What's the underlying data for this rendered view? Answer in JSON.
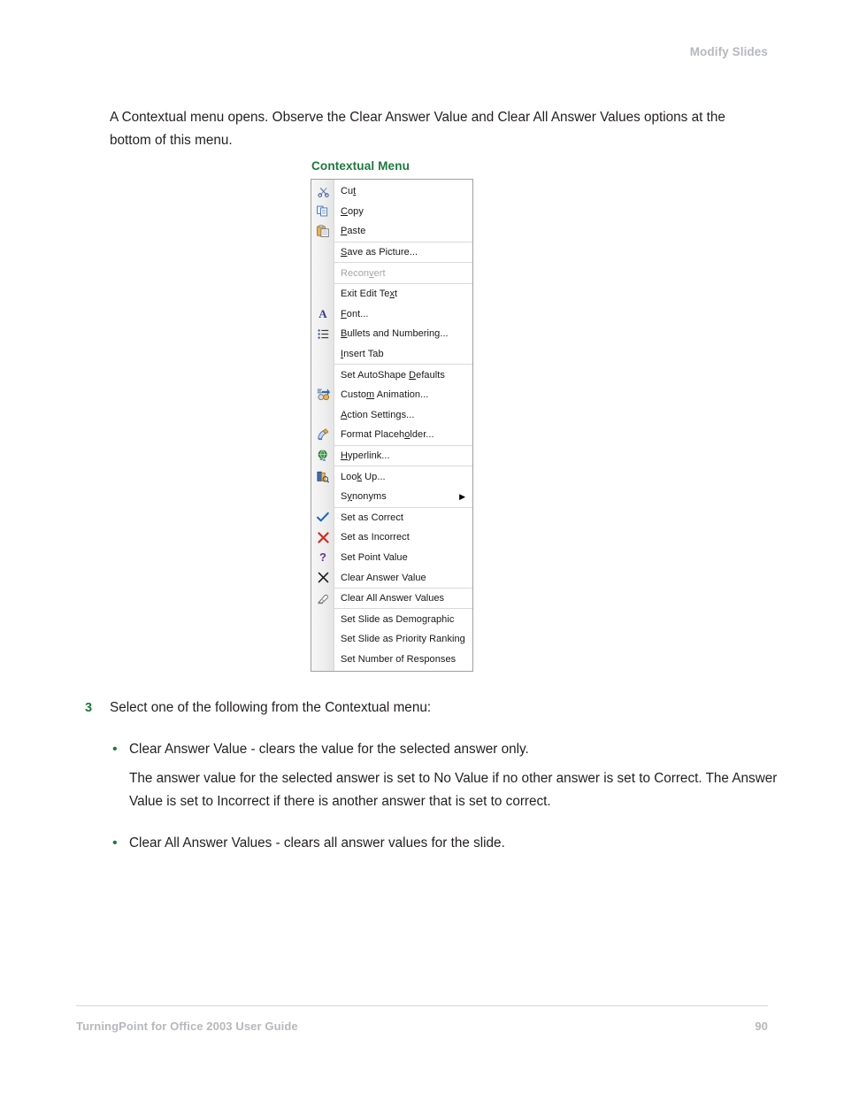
{
  "header": {
    "running_title": "Modify Slides"
  },
  "intro": "A Contextual menu opens. Observe the Clear Answer Value and Clear All Answer Values options at the bottom of this menu.",
  "figure": {
    "caption": "Contextual Menu",
    "menu_items": [
      {
        "label": "Cut",
        "icon": "scissors-icon",
        "glyph": "✂",
        "enabled": true,
        "submenu": false
      },
      {
        "label": "Copy",
        "icon": "copy-icon",
        "glyph": "",
        "enabled": true,
        "submenu": false
      },
      {
        "label": "Paste",
        "icon": "paste-icon",
        "glyph": "",
        "enabled": true,
        "submenu": false
      },
      {
        "label": "Save as Picture...",
        "icon": "",
        "glyph": "",
        "enabled": true,
        "submenu": false
      },
      {
        "label": "Reconvert",
        "icon": "",
        "glyph": "",
        "enabled": false,
        "submenu": false
      },
      {
        "label": "Exit Edit Text",
        "icon": "",
        "glyph": "",
        "enabled": true,
        "submenu": false
      },
      {
        "label": "Font...",
        "icon": "font-icon",
        "glyph": "A",
        "enabled": true,
        "submenu": false
      },
      {
        "label": "Bullets and Numbering...",
        "icon": "bullets-numbering-icon",
        "glyph": "",
        "enabled": true,
        "submenu": false
      },
      {
        "label": "Insert Tab",
        "icon": "",
        "glyph": "",
        "enabled": true,
        "submenu": false
      },
      {
        "label": "Set AutoShape Defaults",
        "icon": "",
        "glyph": "",
        "enabled": true,
        "submenu": false
      },
      {
        "label": "Custom Animation...",
        "icon": "custom-animation-icon",
        "glyph": "",
        "enabled": true,
        "submenu": false
      },
      {
        "label": "Action Settings...",
        "icon": "",
        "glyph": "",
        "enabled": true,
        "submenu": false
      },
      {
        "label": "Format Placeholder...",
        "icon": "format-placeholder-icon",
        "glyph": "",
        "enabled": true,
        "submenu": false
      },
      {
        "label": "Hyperlink...",
        "icon": "hyperlink-icon",
        "glyph": "",
        "enabled": true,
        "submenu": false
      },
      {
        "label": "Look Up...",
        "icon": "look-up-icon",
        "glyph": "",
        "enabled": true,
        "submenu": false
      },
      {
        "label": "Synonyms",
        "icon": "",
        "glyph": "",
        "enabled": true,
        "submenu": true
      },
      {
        "label": "Set as Correct",
        "icon": "check-icon",
        "glyph": "✔",
        "enabled": true,
        "submenu": false
      },
      {
        "label": "Set as Incorrect",
        "icon": "cross-red-icon",
        "glyph": "✖",
        "enabled": true,
        "submenu": false
      },
      {
        "label": "Set Point Value",
        "icon": "question-mark-icon",
        "glyph": "?",
        "enabled": true,
        "submenu": false
      },
      {
        "label": "Clear Answer Value",
        "icon": "clear-x-icon",
        "glyph": "✕",
        "enabled": true,
        "submenu": false
      },
      {
        "label": "Clear All Answer Values",
        "icon": "eraser-icon",
        "glyph": "",
        "enabled": true,
        "submenu": false
      },
      {
        "label": "Set Slide as Demographic",
        "icon": "",
        "glyph": "",
        "enabled": true,
        "submenu": false
      },
      {
        "label": "Set Slide as Priority Ranking",
        "icon": "",
        "glyph": "",
        "enabled": true,
        "submenu": false
      },
      {
        "label": "Set Number of Responses",
        "icon": "",
        "glyph": "",
        "enabled": true,
        "submenu": false
      }
    ],
    "submenu_arrow": "▶"
  },
  "step": {
    "number": "3",
    "text": "Select one of the following from the Contextual menu:",
    "bullet_glyph": "•",
    "bullets": [
      {
        "text": "Clear Answer Value - clears the value for the selected answer only.",
        "sub": "The answer value for the selected answer is set to No Value if no other answer is set to Correct. The Answer Value is set to Incorrect if there is another answer that is set to correct."
      },
      {
        "text": "Clear All Answer Values - clears all answer values for the slide.",
        "sub": ""
      }
    ]
  },
  "footer": {
    "guide_title": "TurningPoint for Office 2003 User Guide",
    "page_number": "90"
  },
  "colors": {
    "accent_green": "#1d7a3c",
    "muted_gray": "#b6b8bb",
    "body_text": "#231f20"
  }
}
